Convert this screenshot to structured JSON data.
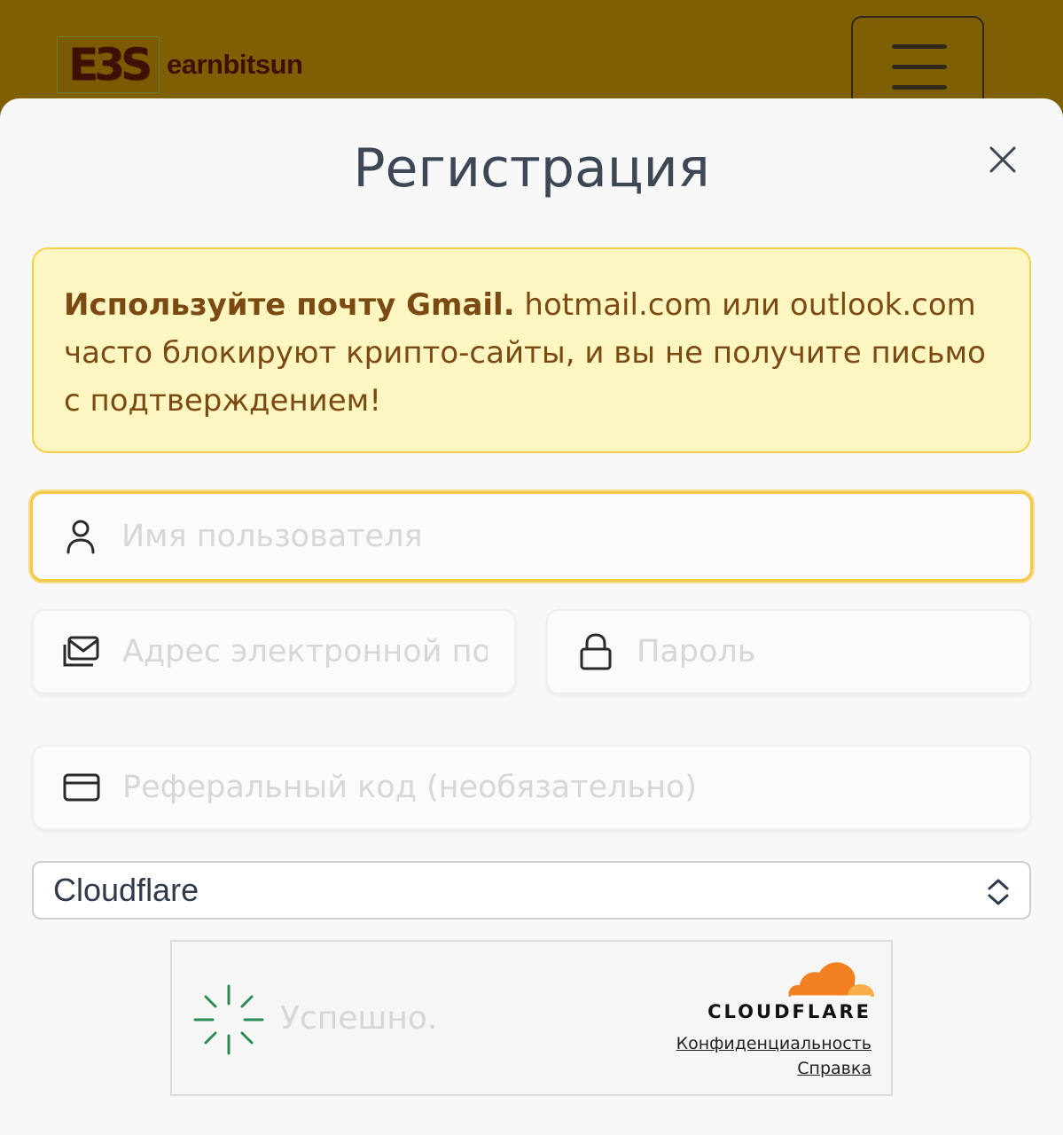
{
  "header": {
    "logo_mark": "E3S",
    "logo_text": "earnbitsun",
    "menu_icon": "hamburger-menu-icon"
  },
  "modal": {
    "title": "Регистрация",
    "close_icon": "close-icon"
  },
  "alert": {
    "bold_text": "Используйте почту Gmail.",
    "text": "hotmail.com или outlook.com часто блокируют крипто-сайты, и вы не получите письмо с подтверждением!",
    "background": "#fdf6c0",
    "border": "#f2d04a"
  },
  "form": {
    "username": {
      "placeholder": "Имя пользователя",
      "value": "",
      "icon": "user-icon"
    },
    "email": {
      "placeholder": "Адрес электронной почты",
      "value": "",
      "icon": "mail-icon"
    },
    "password": {
      "placeholder": "Пароль",
      "value": "",
      "icon": "lock-icon"
    },
    "referral": {
      "placeholder": "Реферальный код (необязательно)",
      "value": "",
      "icon": "card-icon"
    },
    "captcha_provider": {
      "selected": "Cloudflare",
      "icon": "chevron-updown-icon"
    }
  },
  "captcha": {
    "status": "Успешно.",
    "brand": "CLOUDFLARE",
    "privacy_link": "Конфиденциальность",
    "help_link": "Справка",
    "brand_color": "#f38020"
  },
  "colors": {
    "header_bg": "#7e5f04",
    "focus_border": "#f2c94c",
    "title": "#3e4756"
  }
}
